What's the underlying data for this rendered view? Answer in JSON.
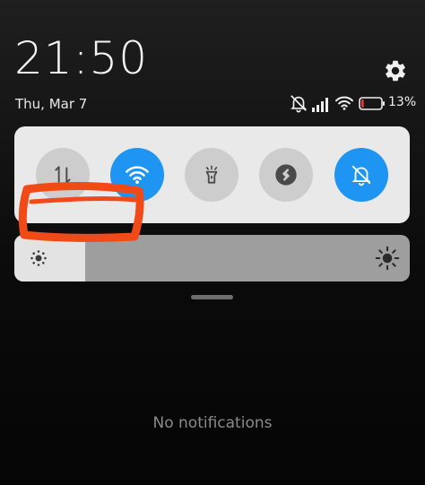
{
  "status_bar": {
    "time": "21:50",
    "date": "Thu, Mar 7",
    "battery_percent": "13%",
    "battery_level": 0.13,
    "icons": [
      "mute-icon",
      "signal-icon",
      "wifi-icon",
      "battery-icon"
    ]
  },
  "quick_settings": {
    "tiles": [
      {
        "icon": "mobile-data-icon",
        "active": false
      },
      {
        "icon": "wifi-icon",
        "active": true
      },
      {
        "icon": "flashlight-icon",
        "active": false
      },
      {
        "icon": "shazam-icon",
        "active": false
      },
      {
        "icon": "mute-icon",
        "active": true
      }
    ]
  },
  "brightness": {
    "level": 0.18
  },
  "notifications": {
    "empty_text": "No notifications"
  },
  "colors": {
    "accent": "#1e95f3",
    "tile_off": "#cdcdcd",
    "panel_bg": "#e9e9e9",
    "annotation": "#f04a18",
    "battery_low": "#e53935"
  }
}
